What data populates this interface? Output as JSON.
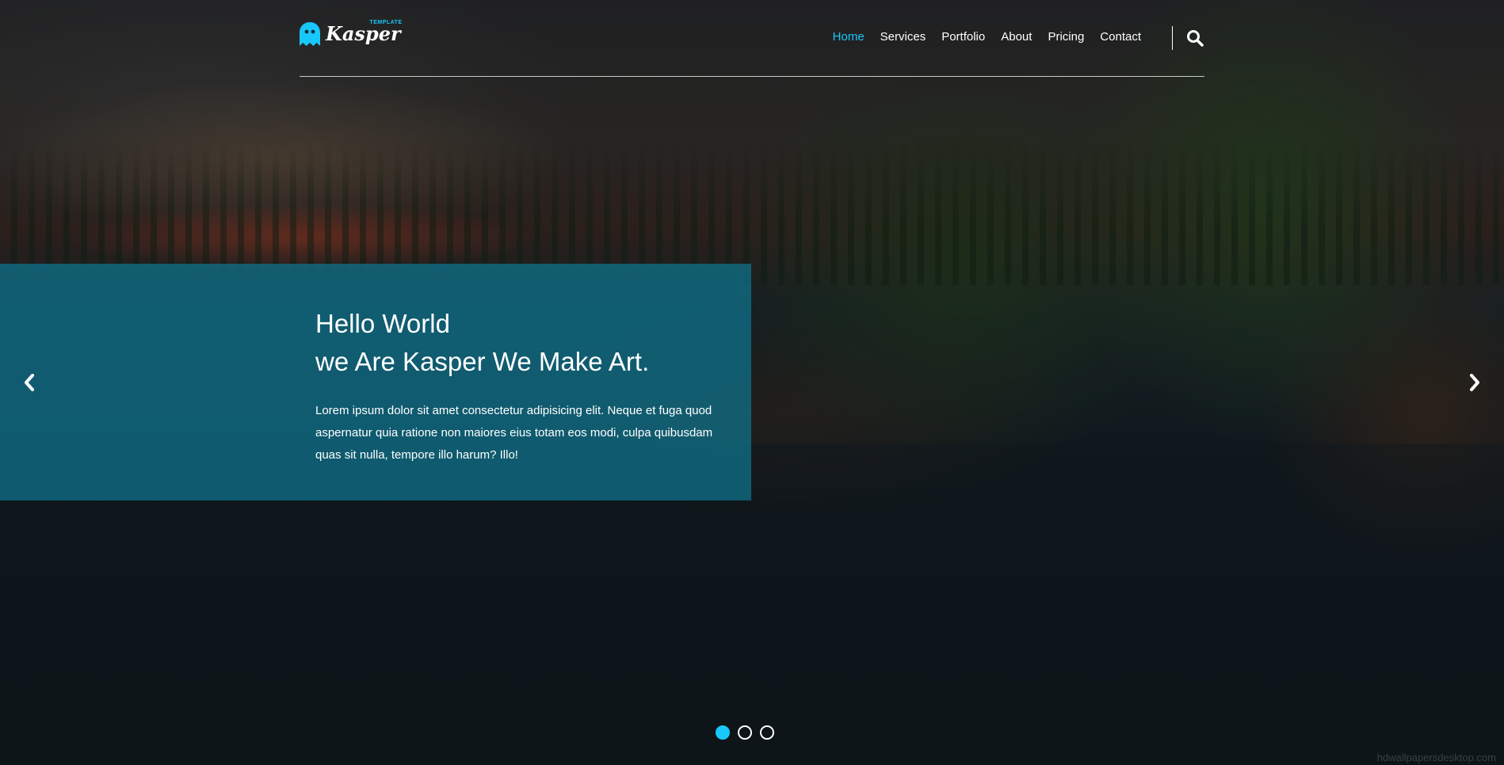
{
  "brand": {
    "name": "Kasper",
    "tagline": "TEMPLATE",
    "accent_color": "#19c8fa"
  },
  "nav": {
    "items": [
      {
        "label": "Home",
        "active": true
      },
      {
        "label": "Services",
        "active": false
      },
      {
        "label": "Portfolio",
        "active": false
      },
      {
        "label": "About",
        "active": false
      },
      {
        "label": "Pricing",
        "active": false
      },
      {
        "label": "Contact",
        "active": false
      }
    ],
    "search_icon": "search-icon"
  },
  "slide": {
    "title_line1": "Hello World",
    "title_line2": "we Are Kasper We Make Art.",
    "description": "Lorem ipsum dolor sit amet consectetur adipisicing elit. Neque et fuga quod aspernatur quia ratione non maiores eius totam eos modi, culpa quibusdam quas sit nulla, tempore illo harum? Illo!",
    "panel_color": "#0f748f"
  },
  "slider": {
    "prev_icon": "chevron-left-icon",
    "next_icon": "chevron-right-icon",
    "bullet_count": 3,
    "active_index": 0
  },
  "watermark": "hdwallpapersdesktop.com"
}
